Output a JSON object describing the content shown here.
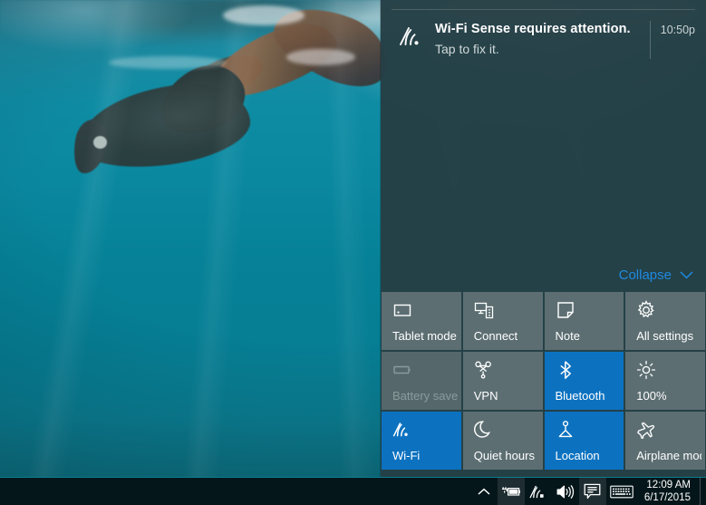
{
  "colors": {
    "action_center_bg": "#253f45",
    "tile_off": "#5c6e72",
    "tile_on": "#0c72c0",
    "tile_disabled_text": "#8b9b9e",
    "accent_link": "#1f8ae0",
    "taskbar_bg": "#05161a",
    "taskbar_accent": "#0b7d92"
  },
  "action_center": {
    "notifications": [
      {
        "icon": "wifi-sense-icon",
        "title": "Wi-Fi Sense requires attention.",
        "body": "Tap to fix it.",
        "time": "10:50p"
      }
    ],
    "collapse": {
      "label": "Collapse",
      "icon": "chevron-down-icon"
    },
    "quick_actions": [
      {
        "label": "Tablet mode",
        "icon": "tablet-icon",
        "state": "off"
      },
      {
        "label": "Connect",
        "icon": "connect-icon",
        "state": "off"
      },
      {
        "label": "Note",
        "icon": "note-icon",
        "state": "off"
      },
      {
        "label": "All settings",
        "icon": "gear-icon",
        "state": "off"
      },
      {
        "label": "Battery saver",
        "icon": "battery-icon",
        "state": "disabled"
      },
      {
        "label": "VPN",
        "icon": "vpn-icon",
        "state": "off"
      },
      {
        "label": "Bluetooth",
        "icon": "bluetooth-icon",
        "state": "on"
      },
      {
        "label": "100%",
        "icon": "brightness-icon",
        "state": "off"
      },
      {
        "label": "Wi-Fi",
        "icon": "wifi-icon",
        "state": "on"
      },
      {
        "label": "Quiet hours",
        "icon": "moon-icon",
        "state": "off"
      },
      {
        "label": "Location",
        "icon": "location-icon",
        "state": "on"
      },
      {
        "label": "Airplane mode",
        "icon": "airplane-icon",
        "state": "off"
      }
    ]
  },
  "taskbar": {
    "tray": [
      {
        "name": "show-hidden-icons-button",
        "icon": "chevron-up-icon",
        "hover": false
      },
      {
        "name": "battery-tray-button",
        "icon": "battery-charging-icon",
        "hover": true
      },
      {
        "name": "network-tray-button",
        "icon": "wifi-icon",
        "hover": false
      },
      {
        "name": "volume-tray-button",
        "icon": "speaker-icon",
        "hover": false
      },
      {
        "name": "action-center-button",
        "icon": "action-center-icon",
        "hover": true
      },
      {
        "name": "touch-keyboard-button",
        "icon": "keyboard-icon",
        "hover": false
      }
    ],
    "clock": {
      "time": "12:09 AM",
      "date": "6/17/2015"
    }
  },
  "desktop": {
    "wallpaper_description": "underwater-swimmer-photo"
  }
}
